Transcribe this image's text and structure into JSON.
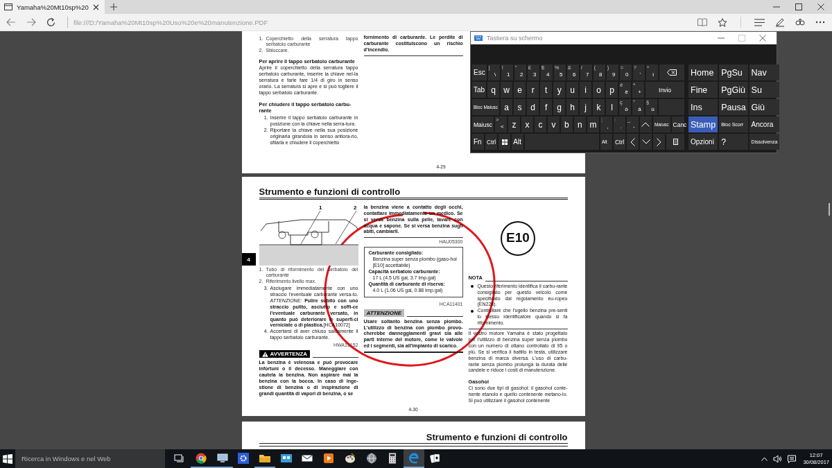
{
  "browser": {
    "tab_title": "Yamaha%20Mt10sp%20",
    "address": "file:///D:/Yamaha%20Mt10sp%20Uso%20e%20manutenzione.PDF"
  },
  "page_1": {
    "columns": [
      [
        {
          "kind": "captions",
          "items": [
            {
              "num": "1.",
              "text": "Coperchietto della serratura tappo serbatoio carburante"
            },
            {
              "num": "2.",
              "text": "Sbloccare."
            }
          ]
        },
        {
          "kind": "heading",
          "text": "Per aprire il tappo serbatoio carburante"
        },
        {
          "kind": "para",
          "text": "Aprire il coperchietto della serratura tappo serbatoio carburante, inserire la chiave nel-la serratura e farle fare 1/4 di giro in senso orario. La serratura si apre e si può togliere il tappo serbatoio carburante."
        },
        {
          "kind": "heading",
          "text": "Per chiudere il tappo serbatoio carbu-rante"
        },
        {
          "kind": "steps",
          "items": [
            {
              "num": "1.",
              "text": "Inserire il tappo serbatoio carburante in posizione con la chiave nella serra-tura."
            },
            {
              "num": "2.",
              "text": "Riportare la chiave nella sua posizione originaria girandola in senso antiora-rio, sfilarla e chiudere il coperchietto"
            }
          ]
        }
      ],
      [
        {
          "kind": "bold",
          "text": "fornimento di carburante. Le perdite di carburante costituiscono un rischio d'incendio."
        },
        {
          "kind": "rule"
        }
      ]
    ],
    "page_number": "4-29"
  },
  "page_2": {
    "title": "Strumento e funzioni di controllo",
    "side_tab": "4",
    "columns": [
      [
        {
          "kind": "figure",
          "callouts": [
            "1",
            "2"
          ]
        },
        {
          "kind": "captions",
          "items": [
            {
              "num": "1.",
              "text": "Tubo di rifornimento del serbatoio del carburante"
            },
            {
              "num": "2.",
              "text": "Riferimento livello max."
            }
          ]
        },
        {
          "kind": "steps",
          "items": [
            {
              "num": "3.",
              "text": "Asciugare immediatamente con uno straccio l'eventuale carburante versa-to. *ATTENZIONE:* **Pulire subito con uno straccio pulito, asciutto e soffi-ce l'eventuale carburante versato, in quanto può deteriorare le superfi-ci verniciate o di plastica.**",
              "ref": "[HCA10072]"
            },
            {
              "num": "4.",
              "text": "Accertarsi di aver chiuso saldamente il tappo serbatoio carburante."
            }
          ]
        },
        {
          "kind": "ref",
          "text": "HWA15152"
        },
        {
          "kind": "warning",
          "text": "AVVERTENZA"
        },
        {
          "kind": "bold",
          "text": "La benzina è velenosa e può provocare infortuni o il decesso. Maneggiare con cautela la benzina. Non aspirare mai la benzina con la bocca. In caso di inge-stione di benzina o di inspirazione di grandi quantità di vapori di benzina, o se"
        }
      ],
      [
        {
          "kind": "bold",
          "text": "la benzina viene a contatto degli occhi, contattare immediatamente un medico. Se si versa benzina sulla pelle, lavare con acqua e sapone. Se si versa benzina sugli abiti, cambiarli."
        },
        {
          "kind": "rule"
        },
        {
          "kind": "ref",
          "text": "HAU05300"
        },
        {
          "kind": "spec",
          "lines": [
            {
              "kind": "label",
              "text": "Carburante consigliato:"
            },
            {
              "kind": "value",
              "text": "Benzina super senza piombo (gaso-hol [E10] accettabile)"
            },
            {
              "kind": "label",
              "text": "Capacità serbatoio carburante:"
            },
            {
              "kind": "value",
              "text": "17 L (4.5 US gal, 3.7 Imp.gal)"
            },
            {
              "kind": "label",
              "text": "Quantità di carburante di riserva:"
            },
            {
              "kind": "value",
              "text": "4.0 L (1.06 US gal, 0.88 Imp.gal)"
            }
          ]
        },
        {
          "kind": "ref",
          "text": "HCA11401"
        },
        {
          "kind": "caution",
          "text": "ATTENZIONE"
        },
        {
          "kind": "bold",
          "text": "Usare soltanto benzina senza piombo. L'utilizzo di benzina con piombo provo-cherebbe danneggiamenti gravi sia alle parti interne del motore, come le valvole ed i segmenti, sia all'impianto di scarico."
        },
        {
          "kind": "thickrule"
        }
      ],
      [
        {
          "kind": "badge",
          "text": "E10"
        },
        {
          "kind": "note",
          "text": "NOTA"
        },
        {
          "kind": "bullets",
          "items": [
            "Questo riferimento identifica il carbu-rante consigliato per questo veicolo come specificato dal regolamento eu-ropeo (EN228).",
            "Controllare che l'ugello benzina pre-senti lo stesso identificatore quando si fa rifornimento."
          ]
        },
        {
          "kind": "rule"
        },
        {
          "kind": "para",
          "text": "Il vostro motore Yamaha è stato progettato per l'utilizzo di benzina super senza piombo con un numero di ottano controllato di 95 o più. Se si verifica il battito in testa, utilizzare benzina di marca diversa. L'uso di carbu-rante senza piombo prolunga la durata delle candele e riduce i costi di manutenzione."
        },
        {
          "kind": "heading",
          "text": "Gasohol"
        },
        {
          "kind": "para",
          "text": "Ci sono due tipi di gasohol: il gasohol conte-nente etanolo e quello contenente metano-lo. Si può utilizzare il gasohol contenente"
        }
      ]
    ],
    "page_number": "4-30"
  },
  "page_3": {
    "title": "Strumento e funzioni di controllo"
  },
  "keyboard": {
    "title": "Tastiera su schermo",
    "rows": [
      {
        "keys": [
          {
            "kind": "text",
            "label": "Esc"
          },
          {
            "kind": "char",
            "label": "\\",
            "shift": "|"
          },
          {
            "kind": "char",
            "label": "1",
            "shift": "!"
          },
          {
            "kind": "char",
            "label": "2",
            "shift": "\""
          },
          {
            "kind": "char",
            "label": "3",
            "shift": "£"
          },
          {
            "kind": "char",
            "label": "4",
            "shift": "$"
          },
          {
            "kind": "char",
            "label": "5",
            "shift": "%"
          },
          {
            "kind": "char",
            "label": "6",
            "shift": "&"
          },
          {
            "kind": "char",
            "label": "7",
            "shift": "/"
          },
          {
            "kind": "char",
            "label": "8",
            "shift": "("
          },
          {
            "kind": "char",
            "label": "9",
            "shift": ")"
          },
          {
            "kind": "char",
            "label": "0",
            "shift": "="
          },
          {
            "kind": "char",
            "label": "'",
            "shift": "?"
          },
          {
            "kind": "char",
            "label": "ì",
            "shift": "^"
          },
          {
            "kind": "backspace"
          }
        ]
      },
      {
        "keys": [
          {
            "kind": "text",
            "label": "Tab"
          },
          {
            "kind": "char",
            "label": "q"
          },
          {
            "kind": "char",
            "label": "w"
          },
          {
            "kind": "char",
            "label": "e"
          },
          {
            "kind": "char",
            "label": "r"
          },
          {
            "kind": "char",
            "label": "t"
          },
          {
            "kind": "char",
            "label": "y"
          },
          {
            "kind": "char",
            "label": "u"
          },
          {
            "kind": "char",
            "label": "i"
          },
          {
            "kind": "char",
            "label": "o"
          },
          {
            "kind": "char",
            "label": "p"
          },
          {
            "kind": "char",
            "label": "è",
            "shift": "é"
          },
          {
            "kind": "char",
            "label": "+",
            "shift": "*"
          },
          {
            "kind": "enter",
            "label": "Invio"
          }
        ]
      },
      {
        "keys": [
          {
            "kind": "text",
            "label": "Bloc Maiusc"
          },
          {
            "kind": "char",
            "label": "a"
          },
          {
            "kind": "char",
            "label": "s"
          },
          {
            "kind": "char",
            "label": "d"
          },
          {
            "kind": "char",
            "label": "f"
          },
          {
            "kind": "char",
            "label": "g"
          },
          {
            "kind": "char",
            "label": "h"
          },
          {
            "kind": "char",
            "label": "j"
          },
          {
            "kind": "char",
            "label": "k"
          },
          {
            "kind": "char",
            "label": "l"
          },
          {
            "kind": "char",
            "label": "ò",
            "shift": "ç"
          },
          {
            "kind": "char",
            "label": "à",
            "shift": "°"
          },
          {
            "kind": "char",
            "label": "ù",
            "shift": "§"
          },
          {
            "kind": "tail"
          }
        ]
      },
      {
        "keys": [
          {
            "kind": "text",
            "label": "Maiusc"
          },
          {
            "kind": "char",
            "label": "<",
            "shift": ">"
          },
          {
            "kind": "char",
            "label": "z"
          },
          {
            "kind": "char",
            "label": "x"
          },
          {
            "kind": "char",
            "label": "c"
          },
          {
            "kind": "char",
            "label": "v"
          },
          {
            "kind": "char",
            "label": "b"
          },
          {
            "kind": "char",
            "label": "n"
          },
          {
            "kind": "char",
            "label": "m"
          },
          {
            "kind": "char",
            "label": ",",
            "shift": ";"
          },
          {
            "kind": "char",
            "label": ".",
            "shift": ":"
          },
          {
            "kind": "char",
            "label": "-",
            "shift": "_"
          },
          {
            "kind": "up"
          },
          {
            "kind": "tiny",
            "label": "Maiusc"
          },
          {
            "kind": "text",
            "label": "Canc"
          }
        ]
      },
      {
        "keys": [
          {
            "kind": "text",
            "label": "Fn"
          },
          {
            "kind": "text",
            "label": "Ctrl"
          },
          {
            "kind": "win"
          },
          {
            "kind": "text",
            "label": "Alt"
          },
          {
            "kind": "space"
          },
          {
            "kind": "tiny",
            "label": "Alt"
          },
          {
            "kind": "text",
            "label": "Ctrl"
          },
          {
            "kind": "left"
          },
          {
            "kind": "down"
          },
          {
            "kind": "right"
          },
          {
            "kind": "menu"
          }
        ]
      }
    ],
    "nav": [
      {
        "label": "Home",
        "selected": false
      },
      {
        "label": "PgSu",
        "selected": false
      },
      {
        "label": "Nav",
        "selected": false
      },
      {
        "label": "Fine",
        "selected": false
      },
      {
        "label": "PgGiù",
        "selected": false
      },
      {
        "label": "Su",
        "selected": false
      },
      {
        "label": "Ins",
        "selected": false
      },
      {
        "label": "Pausa",
        "selected": false
      },
      {
        "label": "Giù",
        "selected": false
      },
      {
        "label": "Stamp",
        "selected": true
      },
      {
        "label": "Bloc Scorr",
        "selected": false
      },
      {
        "label": "Ancora",
        "selected": false
      },
      {
        "label": "Opzioni",
        "selected": false
      },
      {
        "label": "?",
        "selected": false
      },
      {
        "label": "Dissolvenza",
        "selected": false
      }
    ]
  },
  "taskbar": {
    "search_placeholder": "Ricerca in Windows e nel Web",
    "apps": [
      {
        "running": false,
        "selected": false
      },
      {
        "running": true,
        "selected": false
      },
      {
        "running": true,
        "selected": false
      },
      {
        "running": false,
        "selected": false
      },
      {
        "running": true,
        "selected": false
      },
      {
        "running": false,
        "selected": false
      },
      {
        "running": false,
        "selected": false
      },
      {
        "running": false,
        "selected": false
      },
      {
        "running": false,
        "selected": false
      },
      {
        "running": false,
        "selected": false
      },
      {
        "running": false,
        "selected": false
      },
      {
        "running": true,
        "selected": true
      },
      {
        "running": false,
        "selected": false
      }
    ],
    "time": "12:07",
    "date": "30/08/2017"
  }
}
